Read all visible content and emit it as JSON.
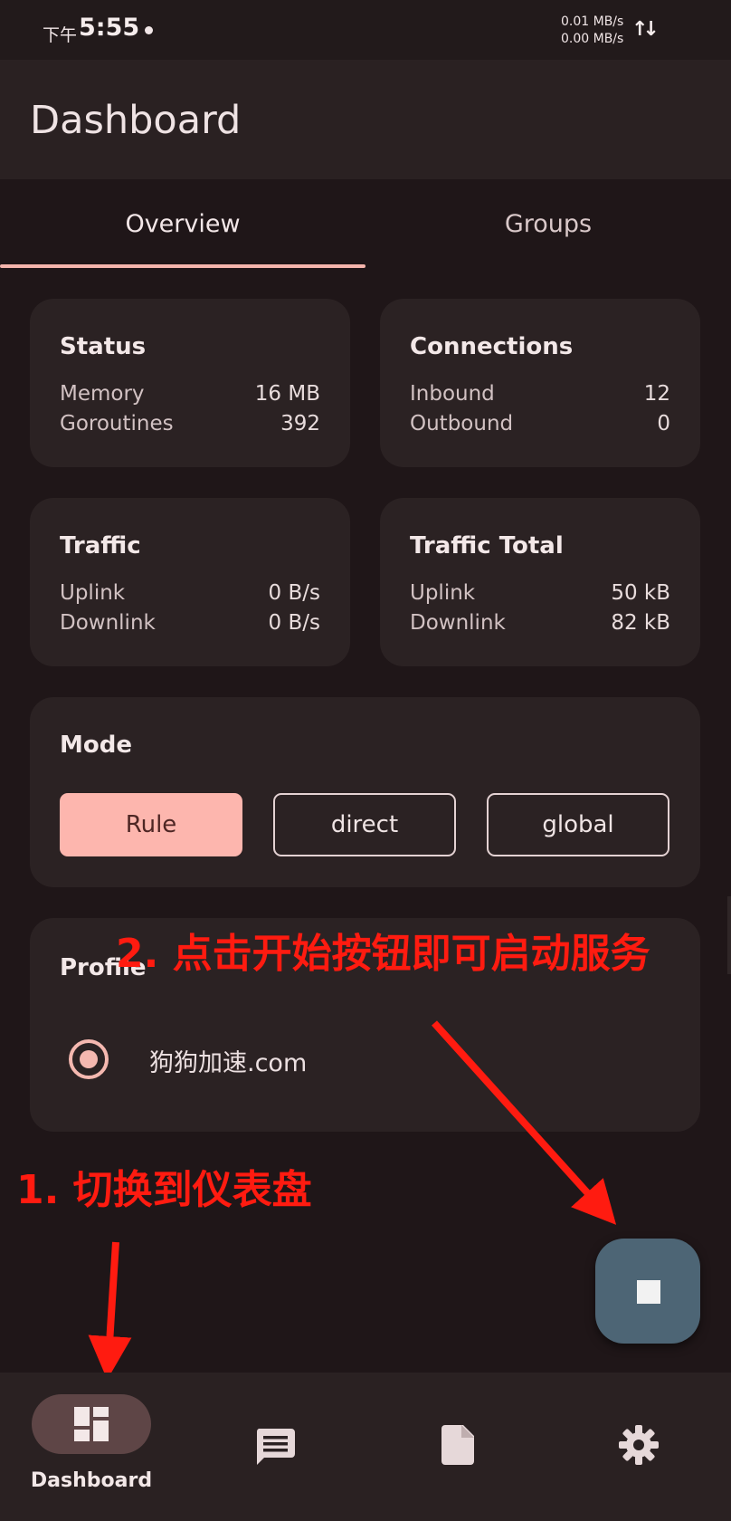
{
  "status_bar": {
    "ampm": "下午",
    "time": "5:55",
    "speed_up": "0.01 MB/s",
    "speed_down": "0.00 MB/s",
    "network_icon": "up-down-arrows-icon"
  },
  "app_bar": {
    "title": "Dashboard"
  },
  "tabs": [
    {
      "label": "Overview",
      "selected": true
    },
    {
      "label": "Groups",
      "selected": false
    }
  ],
  "cards": {
    "status": {
      "title": "Status",
      "rows": [
        {
          "label": "Memory",
          "value": "16 MB"
        },
        {
          "label": "Goroutines",
          "value": "392"
        }
      ]
    },
    "connections": {
      "title": "Connections",
      "rows": [
        {
          "label": "Inbound",
          "value": "12"
        },
        {
          "label": "Outbound",
          "value": "0"
        }
      ]
    },
    "traffic": {
      "title": "Traffic",
      "rows": [
        {
          "label": "Uplink",
          "value": "0 B/s"
        },
        {
          "label": "Downlink",
          "value": "0 B/s"
        }
      ]
    },
    "traffic_total": {
      "title": "Traffic Total",
      "rows": [
        {
          "label": "Uplink",
          "value": "50 kB"
        },
        {
          "label": "Downlink",
          "value": "82 kB"
        }
      ]
    }
  },
  "mode": {
    "title": "Mode",
    "options": [
      "Rule",
      "direct",
      "global"
    ],
    "selected": "Rule"
  },
  "profile": {
    "title": "Profile",
    "items": [
      {
        "name": "狗狗加速.com",
        "selected": true
      }
    ]
  },
  "annotations": {
    "step1": "1. 切换到仪表盘",
    "step2": "2. 点击开始按钮即可启动服务",
    "color": "#ff1b10"
  },
  "fab": {
    "icon": "stop-icon",
    "color": "#4d6575"
  },
  "bottom_nav": {
    "items": [
      {
        "label": "Dashboard",
        "icon": "dashboard-icon",
        "selected": true
      },
      {
        "label": "",
        "icon": "message-icon",
        "selected": false
      },
      {
        "label": "",
        "icon": "file-icon",
        "selected": false
      },
      {
        "label": "",
        "icon": "settings-gear-icon",
        "selected": false
      }
    ]
  },
  "colors": {
    "background": "#1f1618",
    "surface": "#2b2223",
    "accent": "#fdb6ae"
  }
}
